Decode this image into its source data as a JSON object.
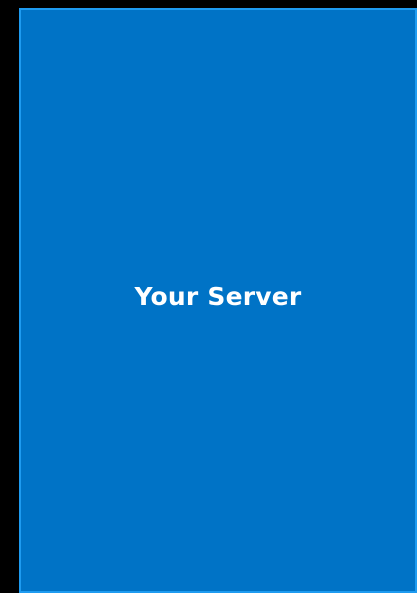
{
  "diagram": {
    "server_label": "Your Server"
  },
  "colors": {
    "background": "#000000",
    "box_fill": "#0073c6",
    "box_border": "#1e9bf0",
    "label_text": "#ffffff"
  }
}
